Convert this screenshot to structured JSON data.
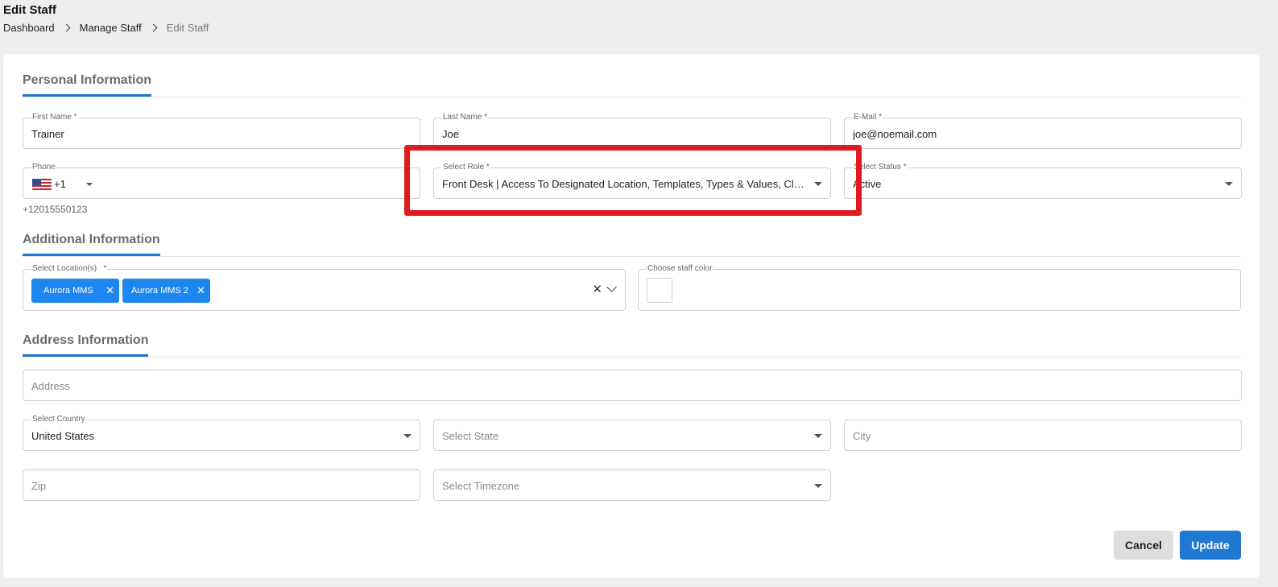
{
  "header": {
    "title": "Edit Staff",
    "breadcrumb": [
      "Dashboard",
      "Manage Staff",
      "Edit Staff"
    ]
  },
  "sections": {
    "personal": "Personal Information",
    "additional": "Additional Information",
    "address": "Address Information"
  },
  "personal": {
    "first_name": {
      "label": "First Name *",
      "value": "Trainer"
    },
    "last_name": {
      "label": "Last Name *",
      "value": "Joe"
    },
    "email": {
      "label": "E-Mail *",
      "value": "joe@noemail.com"
    },
    "phone": {
      "label": "Phone",
      "dial_code": "+1",
      "formatted": "+12015550123"
    },
    "role": {
      "label": "Select Role *",
      "value": "Front Desk | Access To Designated Location, Templates, Types & Values, Clien..."
    },
    "status": {
      "label": "Select Status *",
      "value": "Active"
    }
  },
  "additional": {
    "locations": {
      "label": "Select Location(s)   *",
      "chips": [
        "Aurora MMS",
        "Aurora MMS 2"
      ]
    },
    "staff_color": {
      "label": "Choose staff color"
    }
  },
  "address": {
    "address_placeholder": "Address",
    "country": {
      "label": "Select Country",
      "value": "United States"
    },
    "state_placeholder": "Select State",
    "city_placeholder": "City",
    "zip_placeholder": "Zip",
    "timezone_placeholder": "Select Timezone"
  },
  "buttons": {
    "cancel": "Cancel",
    "update": "Update"
  },
  "colors": {
    "accent": "#1976d2",
    "chip": "#1e86f0",
    "update_button": "#1f78d1",
    "highlight": "#e01b1f"
  },
  "icons": [
    "chevron-right-icon",
    "us-flag-icon",
    "caret-down-icon",
    "close-icon",
    "chevron-down-icon"
  ]
}
